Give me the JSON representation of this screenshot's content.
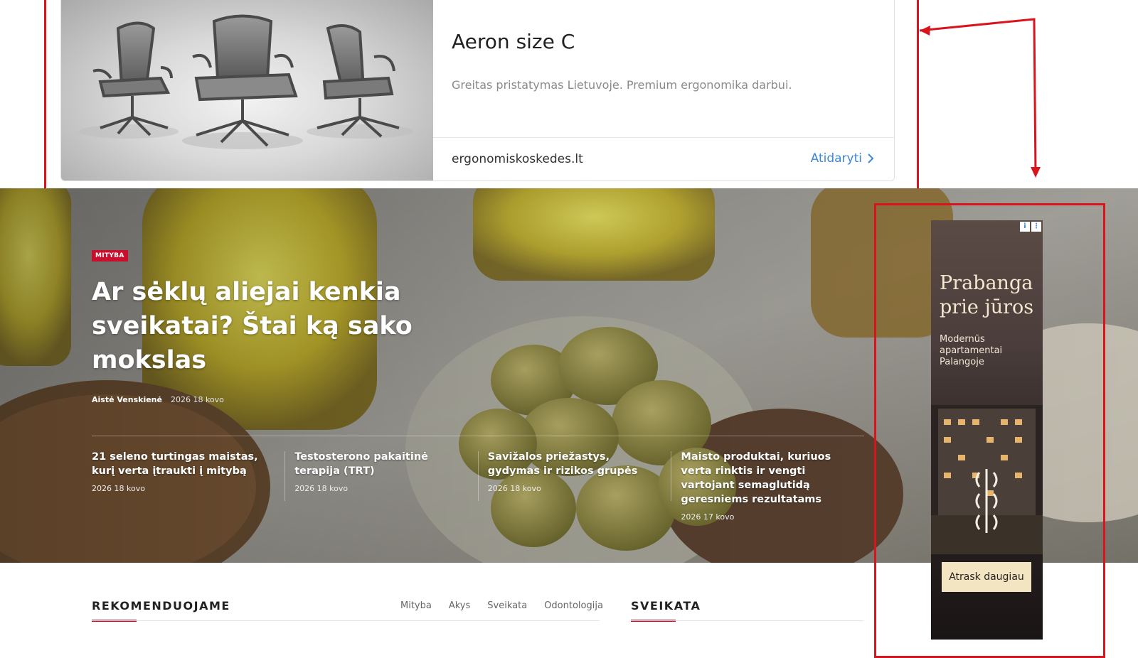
{
  "ad_top": {
    "title": "Aeron size C",
    "description": "Greitas pristatymas Lietuvoje. Premium ergonomika darbui.",
    "domain": "ergonomiskoskedes.lt",
    "cta": "Atidaryti"
  },
  "hero": {
    "category": "MITYBA",
    "title": "Ar sėklų aliejai kenkia sveikatai? Štai ką sako mokslas",
    "author": "Aistė Venskienė",
    "date": "2026 18 kovo",
    "articles": [
      {
        "title": "21 seleno turtingas maistas, kurį verta įtraukti į mitybą",
        "date": "2026 18 kovo"
      },
      {
        "title": "Testosterono pakaitinė terapija (TRT)",
        "date": "2026 18 kovo"
      },
      {
        "title": "Savižalos priežastys, gydymas ir rizikos grupės",
        "date": "2026 18 kovo"
      },
      {
        "title": "Maisto produktai, kuriuos verta rinktis ir vengti vartojant semaglutidą geresniems rezultatams",
        "date": "2026 17 kovo"
      }
    ]
  },
  "side_ad": {
    "info_icon": "i",
    "menu_icon": "⋮",
    "title": "Prabanga prie jūros",
    "subtitle": "Modernūs apartamentai Palangoje",
    "cta": "Atrask daugiau"
  },
  "recommend": {
    "heading": "REKOMENDUOJAME",
    "tabs": [
      "Mityba",
      "Akys",
      "Sveikata",
      "Odontologija"
    ]
  },
  "health": {
    "heading": "SVEIKATA"
  },
  "colors": {
    "accent": "#c8102e",
    "annotation": "#d9141d",
    "link": "#3d87d8"
  }
}
